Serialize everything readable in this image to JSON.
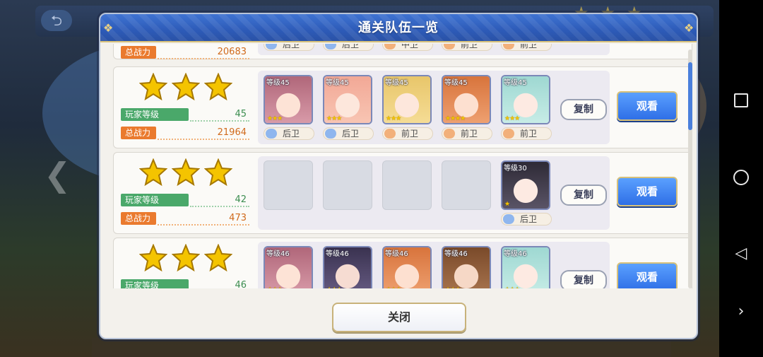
{
  "dialog": {
    "title": "通关队伍一览",
    "close_label": "关闭"
  },
  "labels": {
    "player_level": "玩家等级",
    "total_power": "总战力",
    "copy": "复制",
    "view": "观看"
  },
  "colors": {
    "header_blue": "#2d5bb8",
    "view_button_blue": "#2f6fe6",
    "level_label_green": "#4aa86a",
    "power_label_orange": "#ea7a2e",
    "star_gold": "#f4c400"
  },
  "teams": [
    {
      "partial": "top",
      "total_power": "20683",
      "positions": [
        "后卫",
        "后卫",
        "中卫",
        "前卫",
        "前卫"
      ]
    },
    {
      "stars": 3,
      "player_level": "45",
      "total_power": "21964",
      "members": [
        {
          "level": "等级45",
          "stars": 3,
          "position": "后卫",
          "icon": "pink-hair-girl-portrait"
        },
        {
          "level": "等级45",
          "stars": 3,
          "position": "后卫",
          "icon": "peach-hair-girl-portrait"
        },
        {
          "level": "等级45",
          "stars": 3,
          "position": "前卫",
          "icon": "blonde-girl-portrait"
        },
        {
          "level": "等级45",
          "stars": 4,
          "position": "前卫",
          "icon": "orange-hair-girl-portrait"
        },
        {
          "level": "等级45",
          "stars": 3,
          "position": "前卫",
          "icon": "mint-hair-girl-portrait"
        }
      ]
    },
    {
      "stars": 3,
      "player_level": "42",
      "total_power": "473",
      "members": [
        {
          "empty": true
        },
        {
          "empty": true
        },
        {
          "empty": true
        },
        {
          "empty": true
        },
        {
          "level": "等级30",
          "stars": 1,
          "position": "后卫",
          "icon": "black-hair-girl-portrait"
        }
      ]
    },
    {
      "stars": 3,
      "player_level": "46",
      "members": [
        {
          "level": "等级46",
          "stars": 3,
          "icon": "pink-hair-girl-portrait"
        },
        {
          "level": "等级46",
          "stars": 3,
          "icon": "dark-hair-girl-portrait"
        },
        {
          "level": "等级46",
          "stars": 3,
          "icon": "orange-hair-girl-portrait"
        },
        {
          "level": "等级46",
          "stars": 3,
          "icon": "brown-hair-girl-portrait"
        },
        {
          "level": "等级46",
          "stars": 3,
          "icon": "mint-hair-girl-portrait"
        }
      ]
    }
  ]
}
